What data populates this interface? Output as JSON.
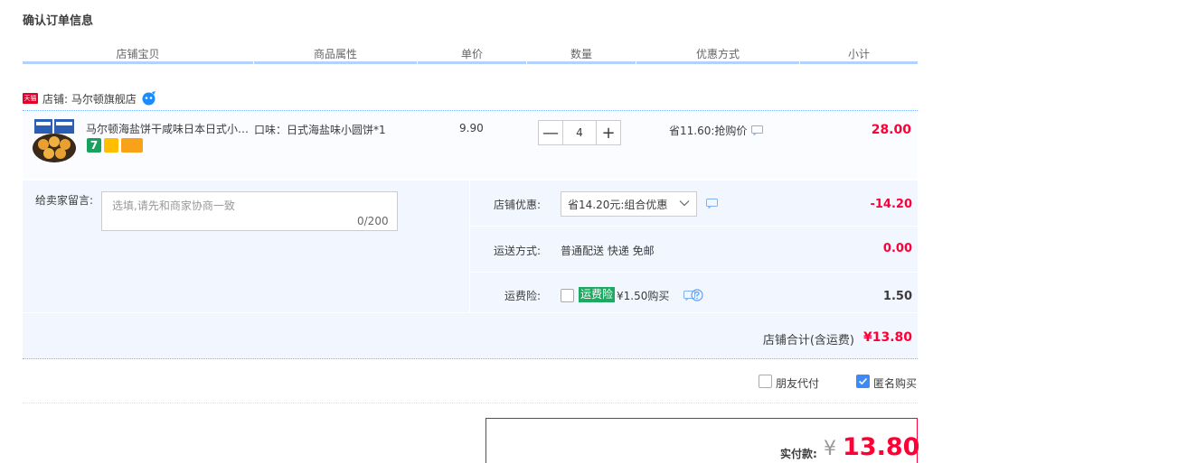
{
  "page": {
    "title": "确认订单信息"
  },
  "columns": [
    "店铺宝贝",
    "商品属性",
    "单价",
    "数量",
    "优惠方式",
    "小计"
  ],
  "shop": {
    "badge": "天猫",
    "label": "店铺: 马尔顿旗舰店"
  },
  "item": {
    "title": "马尔顿海盐饼干咸味日本日式小圆饼干",
    "attr": "口味：日式海盐味小圆饼*1",
    "price": "9.90",
    "qty": "4",
    "qty_minus": "—",
    "qty_plus": "+",
    "promo": "省11.60:抢购价",
    "subtotal": "28.00",
    "svc_icon_1": "7"
  },
  "message": {
    "label": "给卖家留言:",
    "placeholder": "选填,请先和商家协商一致",
    "count": "0/200"
  },
  "discount": {
    "label": "店铺优惠:",
    "selected": "省14.20元:组合优惠",
    "value": "-14.20"
  },
  "shipping": {
    "label": "运送方式:",
    "text": "普通配送 快递 免邮",
    "value": "0.00"
  },
  "insurance": {
    "label": "运费险:",
    "tag": "运费险",
    "price": "¥1.50购买",
    "value": "1.50"
  },
  "shop_total": {
    "label": "店铺合计(含运费)",
    "value": "¥13.80"
  },
  "options": {
    "friend_pay": "朋友代付",
    "anonymous": "匿名购买",
    "anonymous_checked": true
  },
  "payment": {
    "label": "实付款:",
    "yen": "¥",
    "amount": "13.80"
  },
  "colors": {
    "accent_red": "#ff0036",
    "header_line": "#b2d1ff",
    "panel_bg": "#f2f7ff",
    "check_blue": "#3d8af7",
    "insurance_green": "#1fa862"
  },
  "icons": [
    "tmall-icon",
    "wangwang-icon",
    "chat-icon",
    "chevron-down-icon",
    "help-icon",
    "check-icon"
  ]
}
